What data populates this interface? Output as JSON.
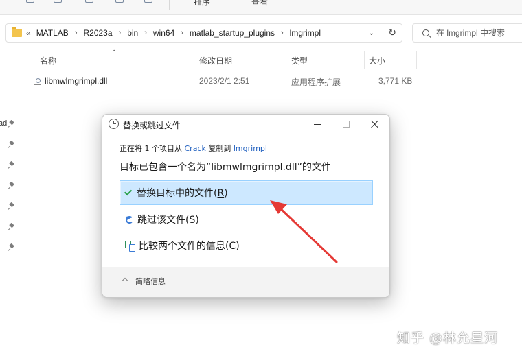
{
  "explorer": {
    "toolbar": {
      "partial_label_1": "排序",
      "partial_label_2": "查看"
    },
    "address_bar": {
      "more": "«",
      "crumbs": [
        "MATLAB",
        "R2023a",
        "bin",
        "win64",
        "matlab_startup_plugins",
        "lmgrimpl"
      ]
    },
    "search": {
      "placeholder": "在 lmgrimpl 中搜索"
    },
    "nav_fragment": "ad",
    "columns": {
      "name": "名称",
      "modified": "修改日期",
      "type": "类型",
      "size": "大小"
    },
    "files": [
      {
        "name": "libmwlmgrimpl.dll",
        "modified": "2023/2/1 2:51",
        "type": "应用程序扩展",
        "size": "3,771 KB"
      }
    ]
  },
  "dialog": {
    "title": "替换或跳过文件",
    "progress": {
      "prefix": "正在将 1 个项目从 ",
      "source": "Crack",
      "middle": " 复制到 ",
      "destination": "lmgrimpl"
    },
    "headline": "目标已包含一个名为“libmwlmgrimpl.dll”的文件",
    "options": [
      {
        "label": "替换目标中的文件",
        "key": "R",
        "icon": "check-icon",
        "selected": true
      },
      {
        "label": "跳过该文件",
        "key": "S",
        "icon": "skip-icon",
        "selected": false
      },
      {
        "label": "比较两个文件的信息",
        "key": "C",
        "icon": "compare-icon",
        "selected": false
      }
    ],
    "details_label": "简略信息"
  },
  "watermark": "知乎 @林允星河",
  "colors": {
    "accent_selection": "#cde8ff",
    "link": "#1f5fbf",
    "annotation_arrow": "#e53935"
  }
}
